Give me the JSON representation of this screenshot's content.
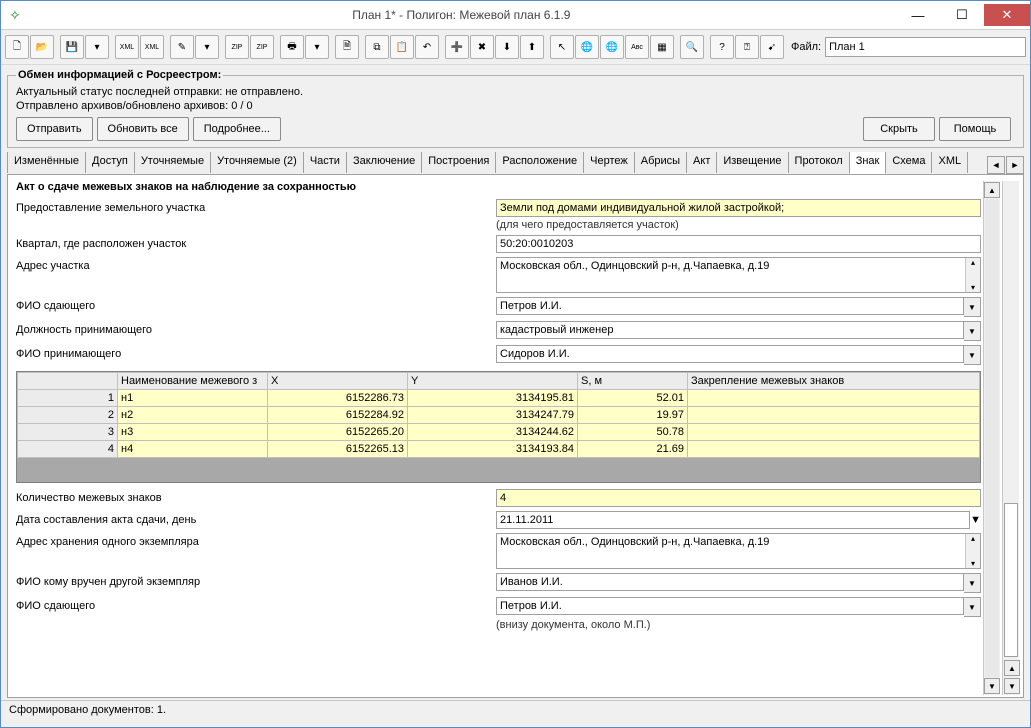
{
  "window": {
    "title": "План 1* - Полигон: Межевой план 6.1.9"
  },
  "toolbar": {
    "file_label": "Файл:",
    "file_value": "План 1"
  },
  "rosreestr": {
    "legend": "Обмен информацией с Росреестром:",
    "status1": "Актуальный статус последней отправки: не отправлено.",
    "status2": "Отправлено архивов/обновлено архивов: 0 / 0",
    "send": "Отправить",
    "refresh": "Обновить все",
    "more": "Подробнее...",
    "hide": "Скрыть",
    "help": "Помощь"
  },
  "tabs": {
    "items": [
      "Изменённые",
      "Доступ",
      "Уточняемые",
      "Уточняемые (2)",
      "Части",
      "Заключение",
      "Построения",
      "Расположение",
      "Чертеж",
      "Абрисы",
      "Акт",
      "Извещение",
      "Протокол",
      "Знак",
      "Схема",
      "XML"
    ],
    "active_index": 13
  },
  "form": {
    "section": "Акт о сдаче межевых знаков на наблюдение за сохранностью",
    "land_grant_label": "Предоставление земельного участка",
    "land_grant_value": "Земли под домами индивидуальной жилой застройкой;",
    "land_grant_hint": "(для чего предоставляется участок)",
    "kvartal_label": "Квартал, где расположен участок",
    "kvartal_value": "50:20:0010203",
    "address_label": "Адрес участка",
    "address_value": "Московская обл., Одинцовский р-н, д.Чапаевка, д.19",
    "giver_fio_label": "ФИО сдающего",
    "giver_fio_value": "Петров И.И.",
    "receiver_post_label": "Должность принимающего",
    "receiver_post_value": "кадастровый инженер",
    "receiver_fio_label": "ФИО принимающего",
    "receiver_fio_value": "Сидоров И.И.",
    "count_label": "Количество межевых знаков",
    "count_value": "4",
    "date_label": "Дата составления акта сдачи, день",
    "date_value": "21.11.2011",
    "storage_label": "Адрес хранения одного экземпляра",
    "storage_value": "Московская обл., Одинцовский р-н, д.Чапаевка, д.19",
    "other_copy_label": "ФИО кому вручен другой экземпляр",
    "other_copy_value": "Иванов И.И.",
    "giver_fio2_label": "ФИО сдающего",
    "giver_fio2_value": "Петров И.И.",
    "footer_hint": "(внизу документа, около М.П.)"
  },
  "grid": {
    "headers": [
      "Наименование межевого з",
      "X",
      "Y",
      "S, м",
      "Закрепление межевых  знаков"
    ],
    "rows": [
      {
        "n": "1",
        "name": "н1",
        "x": "6152286.73",
        "y": "3134195.81",
        "s": "52.01",
        "z": ""
      },
      {
        "n": "2",
        "name": "н2",
        "x": "6152284.92",
        "y": "3134247.79",
        "s": "19.97",
        "z": ""
      },
      {
        "n": "3",
        "name": "н3",
        "x": "6152265.20",
        "y": "3134244.62",
        "s": "50.78",
        "z": ""
      },
      {
        "n": "4",
        "name": "н4",
        "x": "6152265.13",
        "y": "3134193.84",
        "s": "21.69",
        "z": ""
      }
    ]
  },
  "statusbar": "Сформировано документов: 1."
}
